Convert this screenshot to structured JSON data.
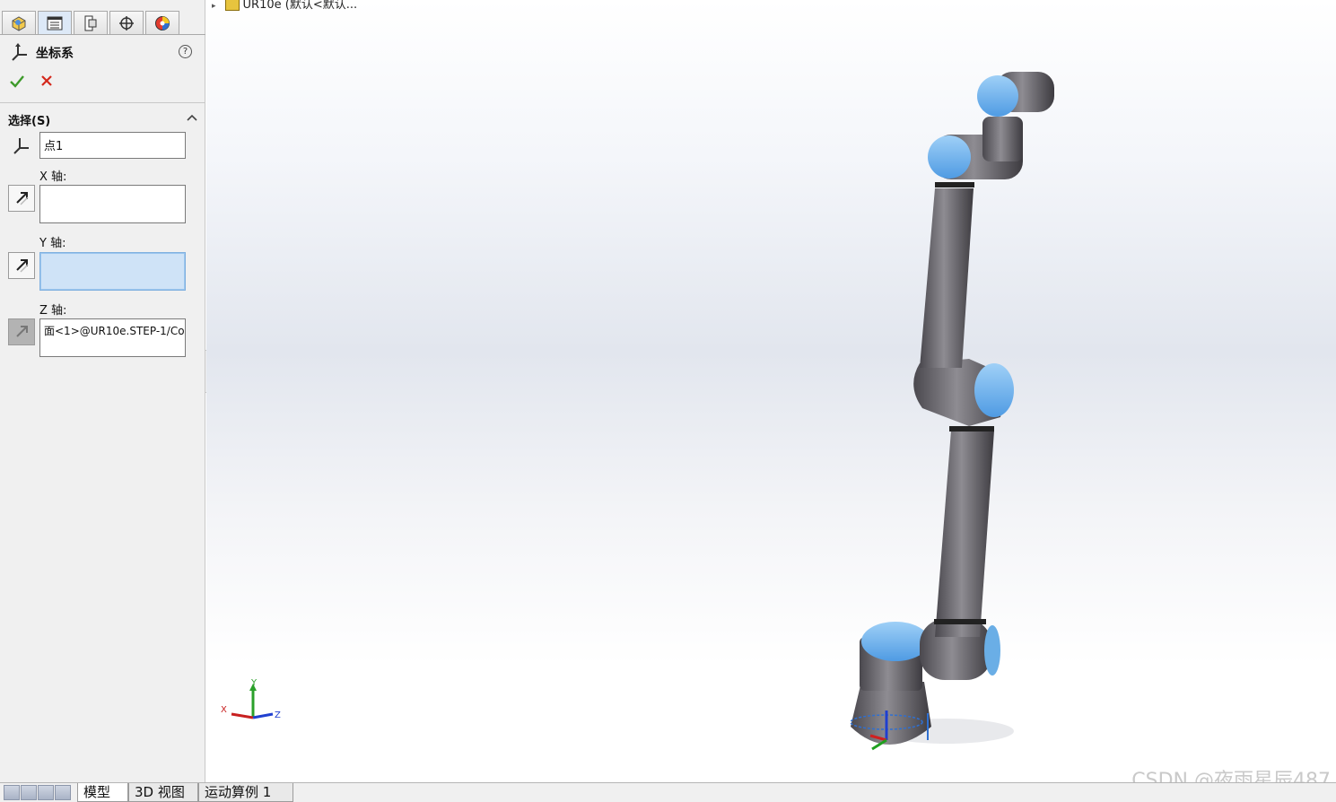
{
  "property_manager": {
    "tabs": [
      "feature-manager-icon",
      "property-manager-icon",
      "configuration-manager-icon",
      "dimxpert-icon",
      "display-manager-icon"
    ],
    "title": "坐标系",
    "help": "?",
    "selection_group": "选择(S)",
    "origin_value": "点1",
    "x_axis_label": "X 轴:",
    "x_axis_value": "",
    "y_axis_label": "Y 轴:",
    "y_axis_value": "",
    "z_axis_label": "Z 轴:",
    "z_axis_value": "面<1>@UR10e.STEP-1/Co"
  },
  "viewport": {
    "tree_item": "UR10e (默认<默认..."
  },
  "triad": {
    "x": "X",
    "y": "Y",
    "z": "Z"
  },
  "bottom_tabs": [
    "模型",
    "3D 视图",
    "运动算例 1"
  ],
  "watermark": "CSDN @夜雨星辰487",
  "colors": {
    "accent_blue": "#4f9be3",
    "joint_blue": "#6aaee6",
    "link_gray": "#6e6c72"
  }
}
